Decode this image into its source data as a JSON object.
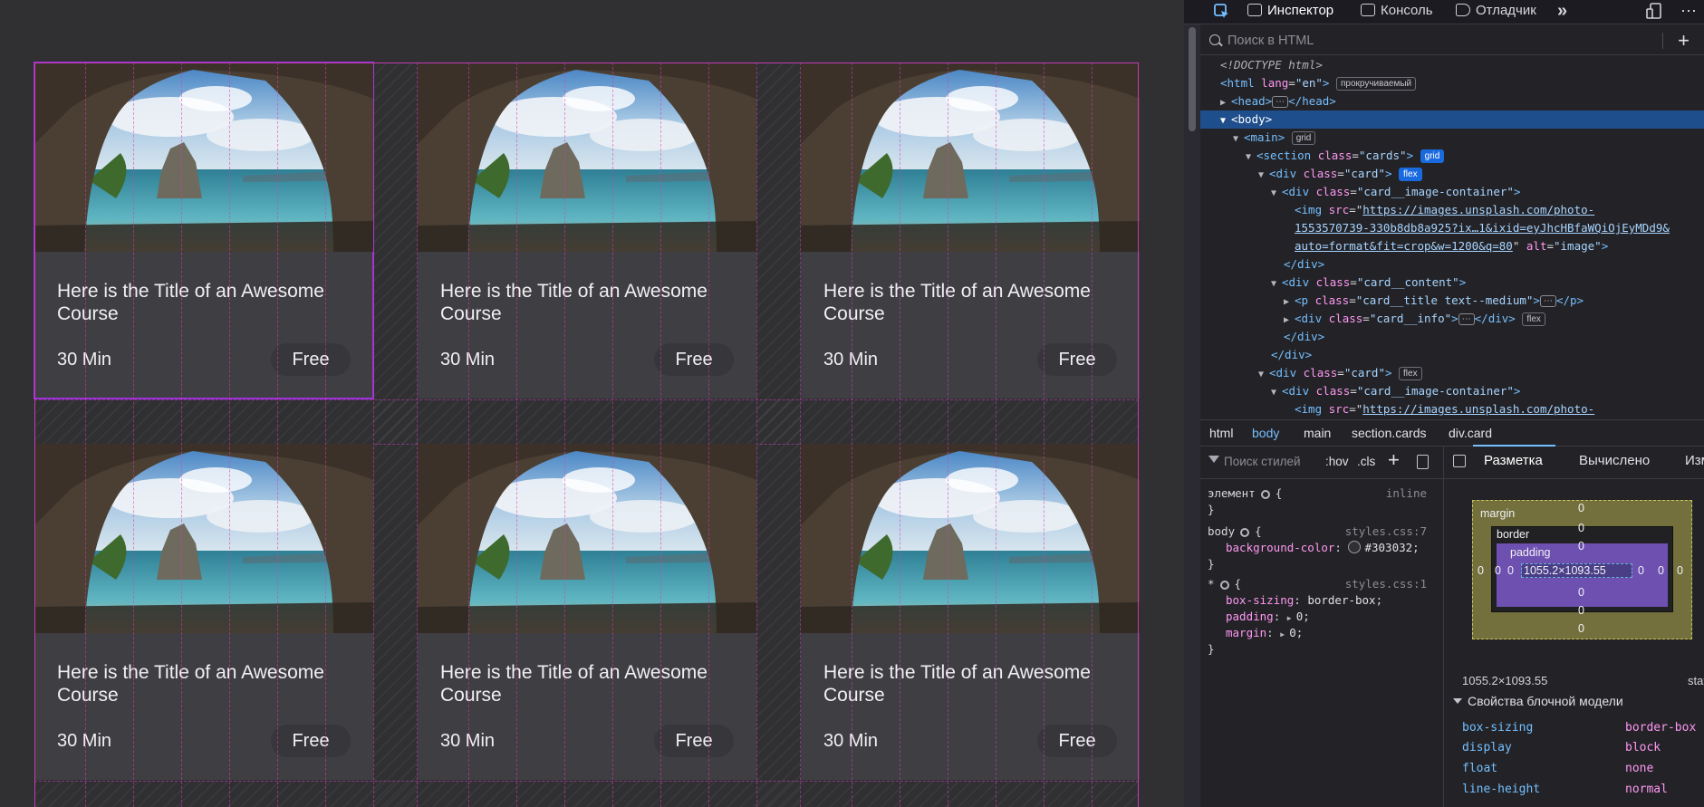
{
  "cards": [
    {
      "title": "Here is the Title of an Awesome Course",
      "duration": "30 Min",
      "price": "Free"
    },
    {
      "title": "Here is the Title of an Awesome Course",
      "duration": "30 Min",
      "price": "Free"
    },
    {
      "title": "Here is the Title of an Awesome Course",
      "duration": "30 Min",
      "price": "Free"
    },
    {
      "title": "Here is the Title of an Awesome Course",
      "duration": "30 Min",
      "price": "Free"
    },
    {
      "title": "Here is the Title of an Awesome Course",
      "duration": "30 Min",
      "price": "Free"
    },
    {
      "title": "Here is the Title of an Awesome Course",
      "duration": "30 Min",
      "price": "Free"
    }
  ],
  "devtools": {
    "tabs": {
      "inspector": "Инспектор",
      "console": "Консоль",
      "debugger": "Отладчик",
      "more": "»"
    },
    "search_placeholder": "Поиск в HTML",
    "add_label": "+",
    "tree": {
      "doctype": "<!DOCTYPE html>",
      "html_open": "html",
      "html_lang_attr": "lang",
      "html_lang_val": "\"en\"",
      "scroll_badge": "прокручиваемый",
      "head_open": "<head>",
      "head_close": "</head>",
      "body": "<body>",
      "main": "<main>",
      "grid_badge": "grid",
      "section_class": "\"cards\"",
      "card_class": "\"card\"",
      "flex_badge": "flex",
      "img_container_class": "\"card__image-container\"",
      "img_src_1": "https://images.unsplash.com/photo-",
      "img_src_2": "1553570739-330b8db8a925?ix…1&ixid=eyJhcHBfaWQiOjEyMDd9&",
      "img_src_3": "auto=format&fit=crop&w=1200&q=80",
      "img_alt": "\"image\"",
      "div_close": "</div>",
      "content_class": "\"card__content\"",
      "title_class": "\"card__title text--medium\"",
      "p_close": "</p>",
      "info_class": "\"card__info\"",
      "img_src_partial": "https://images.unsplash.com/photo-",
      "ellipsis": "⋯"
    },
    "breadcrumbs": [
      "html",
      "body",
      "main",
      "section.cards",
      "div.card"
    ],
    "rules": {
      "filter_placeholder": "Поиск стилей",
      "hov": ":hov",
      "cls": ".cls",
      "element_selector": "элемент",
      "element_src": "inline",
      "body_selector": "body",
      "body_src": "styles.css:7",
      "bg_prop": "background-color",
      "bg_val": "#303032",
      "star_selector": "*",
      "star_src": "styles.css:1",
      "box_sizing_prop": "box-sizing",
      "box_sizing_val": "border-box",
      "padding_prop": "padding",
      "padding_val": "0",
      "margin_prop": "margin",
      "margin_val": "0"
    },
    "layout": {
      "tabs": {
        "layout": "Разметка",
        "computed": "Вычислено",
        "changes": "Изм"
      },
      "margin_label": "margin",
      "border_label": "border",
      "padding_label": "padding",
      "content_size": "1055.2×1093.55",
      "zero": "0",
      "dimensions": "1055.2×1093.55",
      "position": "static",
      "props_heading": "Свойства блочной модели",
      "props": [
        {
          "k": "box-sizing",
          "v": "border-box"
        },
        {
          "k": "display",
          "v": "block"
        },
        {
          "k": "float",
          "v": "none"
        },
        {
          "k": "line-height",
          "v": "normal"
        }
      ]
    }
  }
}
